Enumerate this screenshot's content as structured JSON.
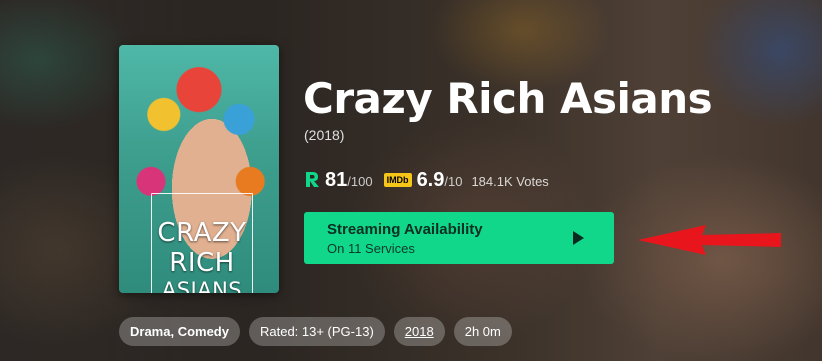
{
  "movie": {
    "title": "Crazy Rich Asians",
    "year": "(2018)",
    "poster": {
      "title_lines": [
        "CRAZY",
        "RICH",
        "ASIANS"
      ]
    }
  },
  "ratings": {
    "reelgood_score": "81",
    "reelgood_max": "/100",
    "imdb_badge": "IMDb",
    "imdb_score": "6.9",
    "imdb_max": "/10",
    "votes": "184.1K Votes",
    "icon": "reelgood-logo-icon"
  },
  "streaming": {
    "title": "Streaming Availability",
    "subtitle": "On 11 Services",
    "icon": "play-icon",
    "accent_color": "#11d78a"
  },
  "annotation": {
    "icon": "red-arrow-icon",
    "color": "#e8161c"
  },
  "tags": {
    "genres": "Drama, Comedy",
    "rating": "Rated: 13+ (PG-13)",
    "year": "2018",
    "runtime": "2h 0m"
  }
}
